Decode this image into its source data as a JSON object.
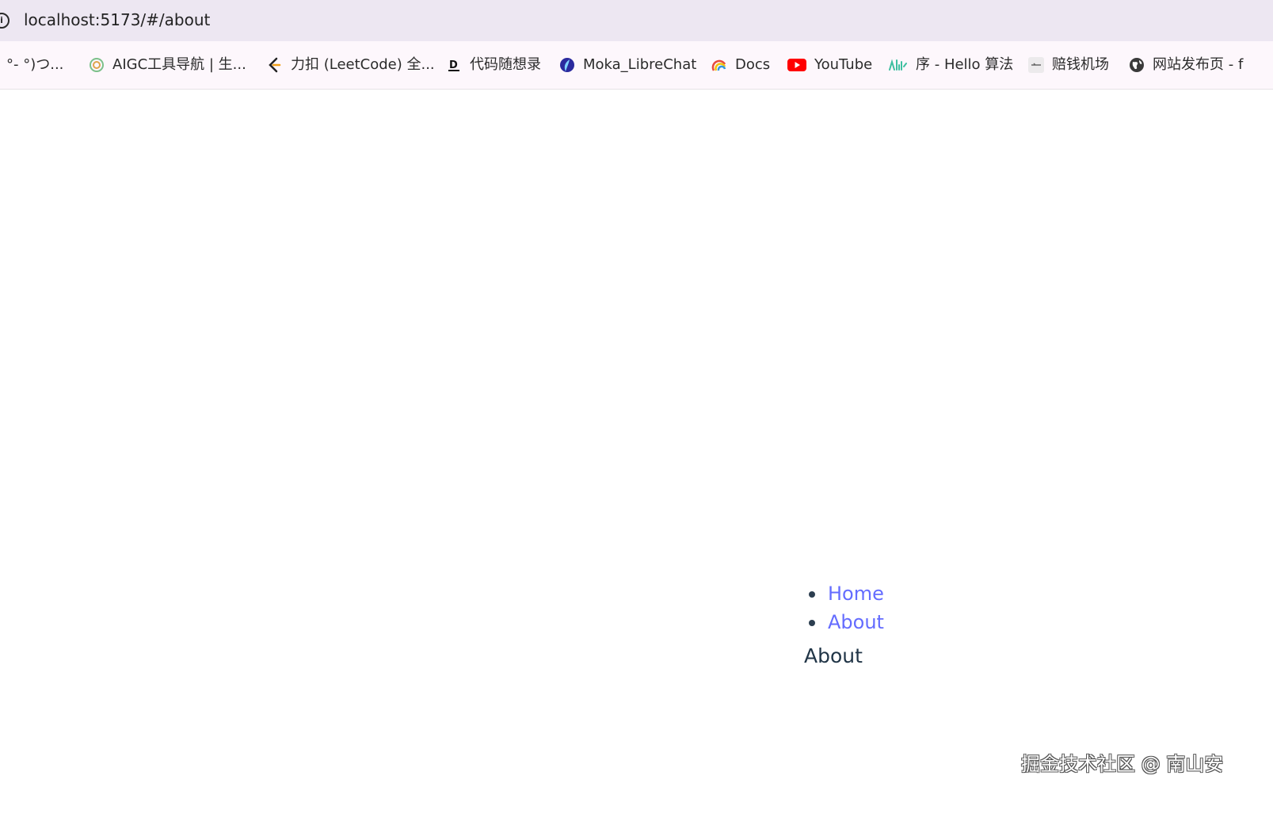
{
  "browser": {
    "url": "localhost:5173/#/about",
    "site_info_icon": "info-icon"
  },
  "bookmarks": [
    {
      "label": "°- °)つ...",
      "icon": "none"
    },
    {
      "label": "AIGC工具导航 | 生...",
      "icon": "aigc-icon"
    },
    {
      "label": "力扣 (LeetCode) 全...",
      "icon": "leetcode-icon"
    },
    {
      "label": "代码随想录",
      "icon": "dm-icon"
    },
    {
      "label": "Moka_LibreChat",
      "icon": "librechat-icon"
    },
    {
      "label": "Docs",
      "icon": "rainbow-icon"
    },
    {
      "label": "YouTube",
      "icon": "youtube-icon"
    },
    {
      "label": "序 - Hello 算法",
      "icon": "hello-algo-icon"
    },
    {
      "label": "赔钱机场",
      "icon": "airport-icon"
    },
    {
      "label": "网站发布页 - f",
      "icon": "globe-icon"
    }
  ],
  "page": {
    "nav": [
      {
        "label": "Home"
      },
      {
        "label": "About"
      }
    ],
    "heading": "About",
    "link_color": "#646cff"
  },
  "watermark": "掘金技术社区 @ 南山安"
}
